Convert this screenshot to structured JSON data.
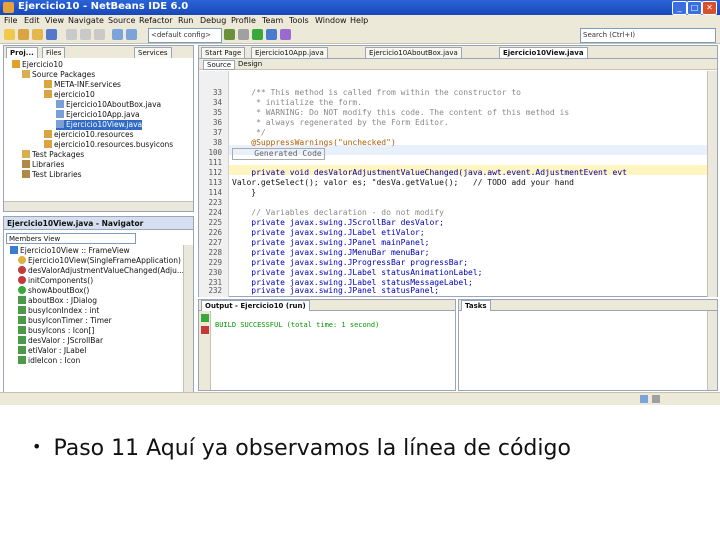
{
  "window": {
    "title": "Ejercicio10 - NetBeans IDE 6.0"
  },
  "menu": [
    "File",
    "Edit",
    "View",
    "Navigate",
    "Source",
    "Refactor",
    "Run",
    "Debug",
    "Profile",
    "Team",
    "Tools",
    "Window",
    "Help"
  ],
  "toolbar": {
    "config_combo": "<default config>",
    "search_placeholder": "Search (Ctrl+I)"
  },
  "projects": {
    "tabs": [
      "Proj...",
      "Files",
      "Services"
    ],
    "tree": [
      "Ejercicio10",
      "Source Packages",
      "META-INF.services",
      "ejercicio10",
      "Ejercicio10AboutBox.java",
      "Ejercicio10App.java",
      "Ejercicio10View.java",
      "ejercicio10.resources",
      "ejercicio10.resources.busyicons",
      "Test Packages",
      "Libraries",
      "Test Libraries"
    ]
  },
  "navigator": {
    "title": "Ejercicio10View.java - Navigator",
    "filter": "Members View",
    "items": [
      "Ejercicio10View :: FrameView",
      "Ejercicio10View(SingleFrameApplication)",
      "desValorAdjustmentValueChanged(Adju...",
      "initComponents()",
      "showAboutBox()",
      "aboutBox : JDialog",
      "busyIconIndex : int",
      "busyIconTimer : Timer",
      "busyIcons : Icon[]",
      "desValor : JScrollBar",
      "etiValor : JLabel",
      "idleIcon : Icon"
    ]
  },
  "editor": {
    "tabs": [
      "Start Page",
      "Ejercicio10App.java",
      "Ejercicio10AboutBox.java",
      "Ejercicio10View.java"
    ],
    "subtabs": [
      "Source",
      "Design"
    ],
    "lines": [
      {
        "n": "33",
        "text": "    /** This method is called from within the constructor to"
      },
      {
        "n": "34",
        "text": "     * initialize the form."
      },
      {
        "n": "35",
        "text": "     * WARNING: Do NOT modify this code. The content of this method is"
      },
      {
        "n": "36",
        "text": "     * always regenerated by the Form Editor."
      },
      {
        "n": "37",
        "text": "     */"
      },
      {
        "n": "38",
        "text": "    @SuppressWarnings(\"unchecked\")"
      },
      {
        "n": "100",
        "text": "    Generated Code"
      },
      {
        "n": "111",
        "text": ""
      },
      {
        "n": "112",
        "text": "    private void desValorAdjustmentValueChanged(java.awt.event.AdjustmentEvent evt"
      },
      {
        "n": "113",
        "text": "Valor.getSelect(); valor es; \"desVa.getValue();   // TODO add your hand"
      },
      {
        "n": "114",
        "text": "    }"
      },
      {
        "n": "223",
        "text": ""
      },
      {
        "n": "224",
        "text": "    // Variables declaration - do not modify"
      },
      {
        "n": "225",
        "text": "    private javax.swing.JScrollBar desValor;"
      },
      {
        "n": "226",
        "text": "    private javax.swing.JLabel etiValor;"
      },
      {
        "n": "227",
        "text": "    private javax.swing.JPanel mainPanel;"
      },
      {
        "n": "228",
        "text": "    private javax.swing.JMenuBar menuBar;"
      },
      {
        "n": "229",
        "text": "    private javax.swing.JProgressBar progressBar;"
      },
      {
        "n": "230",
        "text": "    private javax.swing.JLabel statusAnimationLabel;"
      },
      {
        "n": "231",
        "text": "    private javax.swing.JLabel statusMessageLabel;"
      },
      {
        "n": "232",
        "text": "    private javax.swing.JPanel statusPanel;"
      }
    ]
  },
  "output": {
    "tab": "Output - Ejercicio10 (run)",
    "line": "BUILD SUCCESSFUL (total time: 1 second)",
    "tasks_tab": "Tasks"
  },
  "slide": {
    "bullet": "Paso 11 Aquí ya observamos la línea de código"
  }
}
